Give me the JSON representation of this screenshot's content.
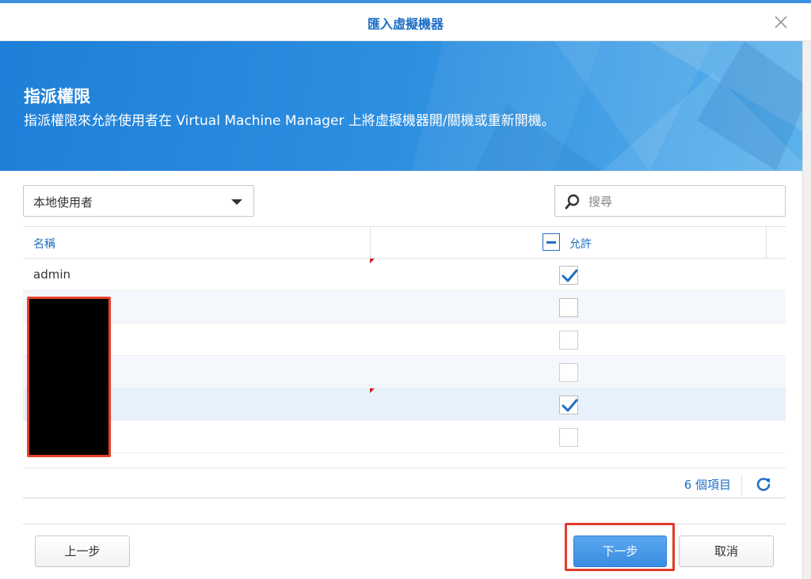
{
  "dialog": {
    "title": "匯入虛擬機器",
    "close_icon": "close-icon"
  },
  "banner": {
    "heading": "指派權限",
    "description": "指派權限來允許使用者在 Virtual Machine Manager 上將虛擬機器開/關機或重新開機。"
  },
  "filter": {
    "user_type": "本地使用者"
  },
  "search": {
    "placeholder": "搜尋",
    "value": ""
  },
  "table": {
    "columns": {
      "name": "名稱",
      "allow": "允許"
    },
    "header_check_state": "partial",
    "rows": [
      {
        "name": "admin",
        "allowed": true,
        "modified": true
      },
      {
        "name": "",
        "allowed": false,
        "modified": false
      },
      {
        "name": "",
        "allowed": false,
        "modified": false
      },
      {
        "name": "",
        "allowed": false,
        "modified": false
      },
      {
        "name": "",
        "allowed": true,
        "modified": true
      },
      {
        "name": "",
        "allowed": false,
        "modified": false
      }
    ],
    "item_count": "6 個項目"
  },
  "buttons": {
    "prev": "上一步",
    "next": "下一步",
    "cancel": "取消"
  },
  "colors": {
    "accent": "#1f6fc5",
    "banner": "#2d8fe0",
    "highlight": "#e23a2b"
  }
}
